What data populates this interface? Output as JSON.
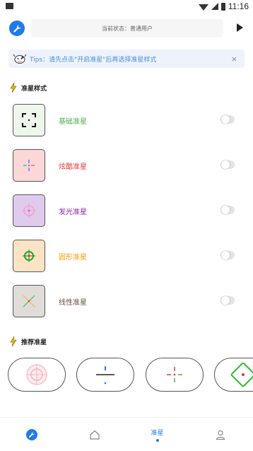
{
  "status_bar": {
    "time": "11:16"
  },
  "top_bar": {
    "state_text": "当前状态：普通用户"
  },
  "tips": {
    "text": "Tips：请先点击\"开启准星\"后再选择准星样式",
    "close": "×"
  },
  "sections": {
    "styles_title": "准星样式",
    "recommended_title": "推荐准星"
  },
  "crosshair_styles": [
    {
      "label": "基础准星",
      "label_color": "#4caf50",
      "bg": "#eef7ea",
      "enabled": false
    },
    {
      "label": "炫酷准星",
      "label_color": "#e53935",
      "bg": "#fbd7d7",
      "enabled": false
    },
    {
      "label": "发光准星",
      "label_color": "#8e24aa",
      "bg": "#e1cbed",
      "enabled": false
    },
    {
      "label": "圆形准星",
      "label_color": "#f59d00",
      "bg": "#fde3c5",
      "enabled": false
    },
    {
      "label": "线性准星",
      "label_color": "#6d4c41",
      "bg": "#e0dcda",
      "enabled": false
    }
  ],
  "bottom_nav": {
    "active_label": "准星"
  },
  "icons": {
    "tool": "wrench-icon",
    "play": "play-icon",
    "home": "home-icon",
    "profile": "user-icon"
  },
  "colors": {
    "accent": "#1e7be8"
  }
}
